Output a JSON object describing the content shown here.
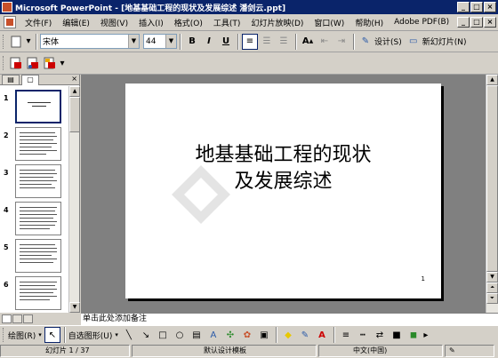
{
  "window": {
    "title": "Microsoft PowerPoint - [地基基础工程的现状及发展综述 潘剑云.ppt]"
  },
  "menu": [
    "文件(F)",
    "编辑(E)",
    "视图(V)",
    "插入(I)",
    "格式(O)",
    "工具(T)",
    "幻灯片放映(D)",
    "窗口(W)",
    "帮助(H)",
    "Adobe PDF(B)"
  ],
  "toolbar": {
    "font_name": "宋体",
    "font_size": "44",
    "bold": "B",
    "italic": "I",
    "underline": "U",
    "design_label": "设计(S)",
    "new_slide_label": "新幻灯片(N)"
  },
  "thumbnails": [
    {
      "num": "1",
      "selected": true
    },
    {
      "num": "2",
      "selected": false
    },
    {
      "num": "3",
      "selected": false
    },
    {
      "num": "4",
      "selected": false
    },
    {
      "num": "5",
      "selected": false
    },
    {
      "num": "6",
      "selected": false
    }
  ],
  "slide": {
    "title_line1": "地基基础工程的现状",
    "title_line2": "及发展综述",
    "number": "1"
  },
  "notes": {
    "placeholder": "单击此处添加备注"
  },
  "drawing": {
    "draw_label": "绘图(R)",
    "autoshape_label": "自选图形(U)"
  },
  "status": {
    "slide_info": "幻灯片 1 / 37",
    "template": "默认设计模板",
    "language": "中文(中国)"
  },
  "colors": {
    "title_bar": "#0a246a",
    "chrome": "#d4d0c8",
    "canvas": "#808080"
  }
}
